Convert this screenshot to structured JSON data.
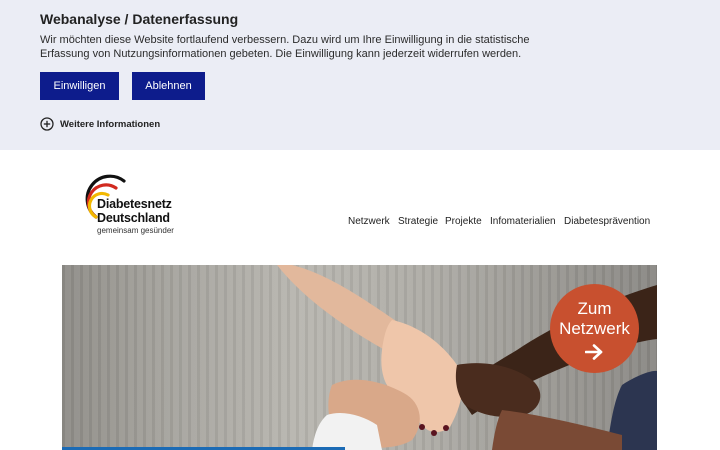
{
  "consent": {
    "title": "Webanalyse / Datenerfassung",
    "text": "Wir möchten diese Website fortlaufend verbessern. Dazu wird um Ihre Einwilligung in die statistische Erfassung von Nutzungsinformationen gebeten. Die Einwilligung kann jederzeit widerrufen werden.",
    "accept_label": "Einwilligen",
    "decline_label": "Ablehnen",
    "more_label": "Weitere Informationen",
    "more_icon": "plus-circle-icon"
  },
  "logo": {
    "line1": "Diabetesnetz",
    "line2": "Deutschland",
    "tagline": "gemeinsam gesünder",
    "colors": [
      "#111111",
      "#d12a1f",
      "#f2b800"
    ]
  },
  "nav": {
    "items": [
      "Netzwerk",
      "Strategie",
      "Projekte",
      "Infomaterialien",
      "Diabetesprävention"
    ]
  },
  "hero": {
    "cta_line1": "Zum",
    "cta_line2": "Netzwerk",
    "cta_icon": "arrow-right-icon",
    "cta_color": "#c8502f",
    "image_subject": "stacked-hands-photo"
  },
  "colors": {
    "banner_bg": "#ebedf5",
    "button_bg": "#0d1c8c",
    "accent_blue": "#1c6bb5"
  }
}
